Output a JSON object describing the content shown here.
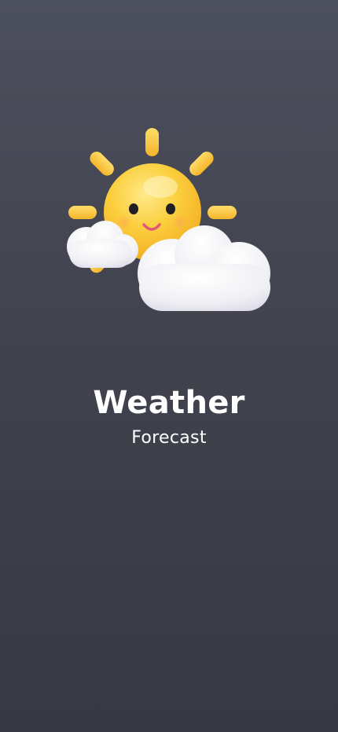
{
  "splash": {
    "illustration_icon": "sun-behind-clouds-icon",
    "title": "Weather",
    "subtitle": "Forecast"
  },
  "colors": {
    "background_top": "#4d505d",
    "background_bottom": "#373842",
    "sun": "#f9c531",
    "ray": "#fbc841",
    "cloud": "#f4f4f7",
    "text": "#ffffff"
  }
}
